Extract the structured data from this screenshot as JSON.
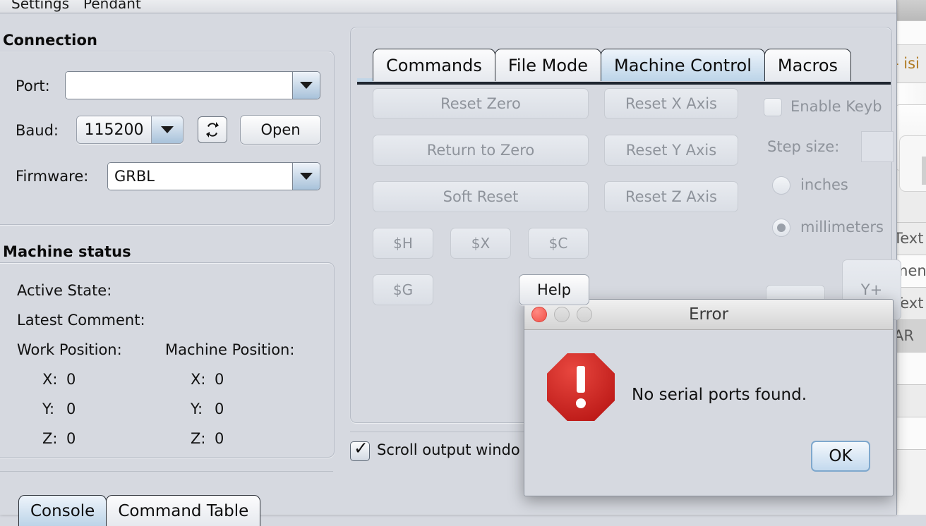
{
  "app": {
    "background_color": "#d6d9e0",
    "menubar": {
      "items": [
        "Settings",
        "Pendant"
      ]
    }
  },
  "connection": {
    "title": "Connection",
    "port": {
      "label": "Port:",
      "value": "",
      "placeholder": ""
    },
    "baud": {
      "label": "Baud:",
      "value": "115200"
    },
    "refresh": {
      "icon": "refresh-icon",
      "label": "↻"
    },
    "open_button": {
      "label": "Open"
    },
    "firmware": {
      "label": "Firmware:",
      "value": "GRBL"
    }
  },
  "machine_status": {
    "title": "Machine status",
    "active_state_label": "Active State:",
    "active_state_value": "",
    "latest_comment_label": "Latest Comment:",
    "latest_comment_value": "",
    "work_position_label": "Work Position:",
    "machine_position_label": "Machine Position:",
    "work": {
      "x_label": "X:",
      "x": "0",
      "y_label": "Y:",
      "y": "0",
      "z_label": "Z:",
      "z": "0"
    },
    "machine": {
      "x_label": "X:",
      "x": "0",
      "y_label": "Y:",
      "y": "0",
      "z_label": "Z:",
      "z": "0"
    }
  },
  "bottom_tabs": {
    "items": [
      {
        "label": "Console",
        "active": true
      },
      {
        "label": "Command Table",
        "active": false
      }
    ]
  },
  "main_tabs": {
    "items": [
      {
        "label": "Commands",
        "active": false
      },
      {
        "label": "File Mode",
        "active": false
      },
      {
        "label": "Machine Control",
        "active": true
      },
      {
        "label": "Macros",
        "active": false
      }
    ]
  },
  "machine_control": {
    "left_buttons": [
      {
        "label": "Reset Zero",
        "disabled": true
      },
      {
        "label": "Return to Zero",
        "disabled": true
      },
      {
        "label": "Soft Reset",
        "disabled": true
      }
    ],
    "right_buttons": [
      {
        "label": "Reset X Axis",
        "disabled": true
      },
      {
        "label": "Reset Y Axis",
        "disabled": true
      },
      {
        "label": "Reset Z Axis",
        "disabled": true
      }
    ],
    "dollar_buttons": [
      {
        "label": "$H",
        "disabled": true
      },
      {
        "label": "$X",
        "disabled": true
      },
      {
        "label": "$C",
        "disabled": true
      },
      {
        "label": "$G",
        "disabled": true
      }
    ],
    "help_button": {
      "label": "Help"
    },
    "enable_keyboard": {
      "label": "Enable Keyb",
      "checked": false,
      "disabled": true
    },
    "step_size": {
      "label": "Step size:",
      "value": ""
    },
    "units": [
      {
        "label": "inches",
        "selected": false
      },
      {
        "label": "millimeters",
        "selected": true
      }
    ],
    "jog_buttons": [
      {
        "label": "Y+",
        "disabled": true
      }
    ]
  },
  "scroll_output": {
    "label": "Scroll output windo",
    "checked": true
  },
  "error_dialog": {
    "title": "Error",
    "message": "No serial ports found.",
    "ok_label": "OK",
    "traffic_lights": [
      "close-red",
      "minimize-gray",
      "zoom-gray"
    ],
    "icon": "error-octagon-icon",
    "accent_color": "#c0110f"
  },
  "background_window": {
    "rows": [
      "- isi",
      "",
      "Text",
      "ment",
      "Text",
      "AR"
    ]
  }
}
